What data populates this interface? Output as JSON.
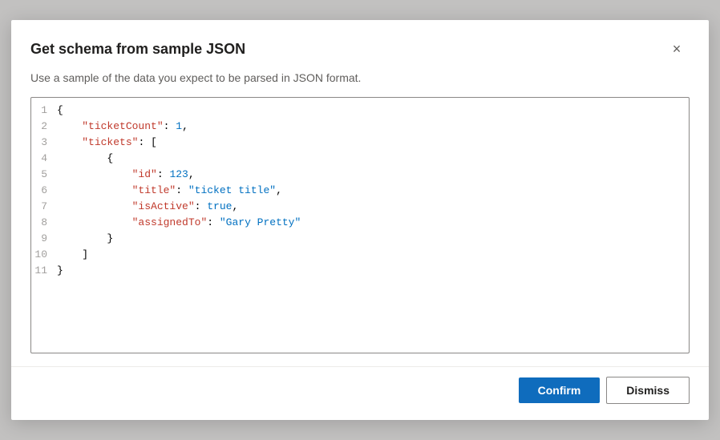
{
  "dialog": {
    "title": "Get schema from sample JSON",
    "description": "Use a sample of the data you expect to be parsed in JSON format.",
    "close_label": "×",
    "confirm_label": "Confirm",
    "dismiss_label": "Dismiss"
  },
  "code": {
    "lines": [
      {
        "num": "1",
        "raw": "{"
      },
      {
        "num": "2",
        "raw": "    \"ticketCount\": 1,"
      },
      {
        "num": "3",
        "raw": "    \"tickets\": ["
      },
      {
        "num": "4",
        "raw": "        {"
      },
      {
        "num": "5",
        "raw": "            \"id\": 123,"
      },
      {
        "num": "6",
        "raw": "            \"title\": \"ticket title\","
      },
      {
        "num": "7",
        "raw": "            \"isActive\": true,"
      },
      {
        "num": "8",
        "raw": "            \"assignedTo\": \"Gary Pretty\""
      },
      {
        "num": "9",
        "raw": "        }"
      },
      {
        "num": "10",
        "raw": "    ]"
      },
      {
        "num": "11",
        "raw": "}"
      }
    ]
  }
}
